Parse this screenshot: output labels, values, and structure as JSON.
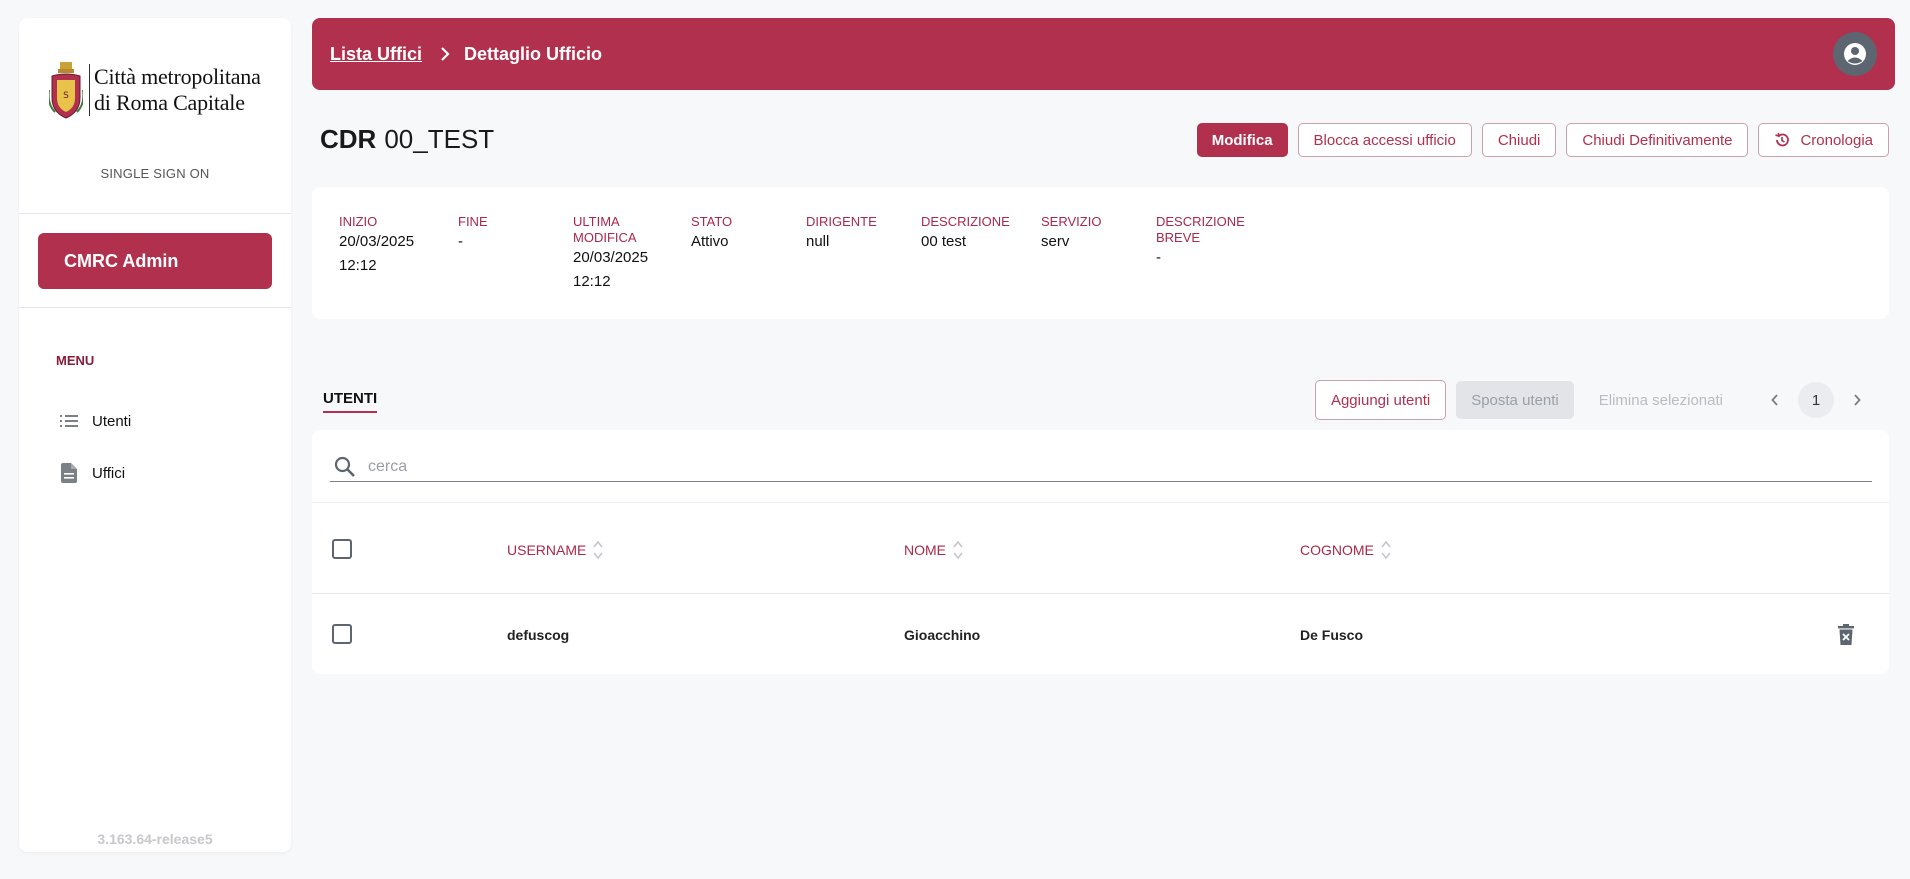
{
  "sidebar": {
    "logo_line1": "Città metropolitana",
    "logo_line2": "di Roma Capitale",
    "sso_label": "SINGLE SIGN ON",
    "admin_button": "CMRC Admin",
    "menu_label": "MENU",
    "items": [
      {
        "label": "Utenti",
        "icon": "list-icon"
      },
      {
        "label": "Uffici",
        "icon": "document-icon"
      }
    ],
    "version": "3.163.64-release5"
  },
  "header": {
    "breadcrumb_link": "Lista Uffici",
    "breadcrumb_current": "Dettaglio Ufficio"
  },
  "title": {
    "prefix": "CDR",
    "code": "00_TEST"
  },
  "actions": {
    "edit": "Modifica",
    "block": "Blocca accessi ufficio",
    "close": "Chiudi",
    "close_final": "Chiudi Definitivamente",
    "history": "Cronologia"
  },
  "details": {
    "inizio": {
      "label": "INIZIO",
      "date": "20/03/2025",
      "time": "12:12"
    },
    "fine": {
      "label": "FINE",
      "value": "-"
    },
    "ultima": {
      "label1": "ULTIMA",
      "label2": "MODIFICA",
      "date": "20/03/2025",
      "time": "12:12"
    },
    "stato": {
      "label": "STATO",
      "value": "Attivo"
    },
    "dirigente": {
      "label": "DIRIGENTE",
      "value": "null"
    },
    "descrizione": {
      "label": "DESCRIZIONE",
      "value": "00 test"
    },
    "servizio": {
      "label": "SERVIZIO",
      "value": "serv"
    },
    "descrizione_breve": {
      "label1": "DESCRIZIONE",
      "label2": "BREVE",
      "value": "-"
    }
  },
  "users": {
    "tab": "UTENTI",
    "add": "Aggiungi utenti",
    "move": "Sposta utenti",
    "delete_selected": "Elimina selezionati",
    "page": "1",
    "search_placeholder": "cerca",
    "columns": {
      "username": "USERNAME",
      "nome": "NOME",
      "cognome": "COGNOME"
    },
    "rows": [
      {
        "username": "defuscog",
        "nome": "Gioacchino",
        "cognome": "De Fusco"
      }
    ]
  },
  "colors": {
    "brand": "#b0304e",
    "label": "#a8294a",
    "background": "#f7f8fa"
  }
}
